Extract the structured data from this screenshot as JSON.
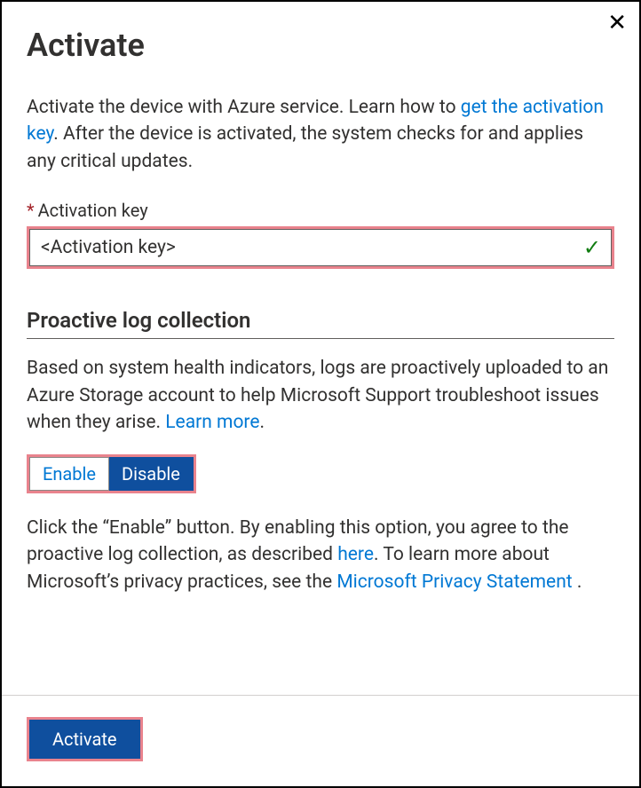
{
  "header": {
    "title": "Activate"
  },
  "intro": {
    "pre": "Activate the device with Azure service. Learn how to ",
    "link": "get the activation key",
    "post": ". After the device is activated, the system checks for and applies any critical updates."
  },
  "field": {
    "label": "Activation key",
    "value": "<Activation key>"
  },
  "section": {
    "title": "Proactive log collection",
    "desc_pre": "Based on system health indicators, logs are proactively uploaded to an Azure Storage account to help Microsoft Support troubleshoot issues when they arise. ",
    "desc_link": "Learn more",
    "desc_post": "."
  },
  "toggle": {
    "enable": "Enable",
    "disable": "Disable"
  },
  "agree": {
    "t1": "Click the “Enable” button. By enabling this option, you agree to the proactive log collection, as described ",
    "here": "here",
    "t2": ". To learn more about Microsoft’s privacy practices, see the ",
    "privacy": "Microsoft Privacy Statement",
    "t3": " ."
  },
  "footer": {
    "activate": "Activate"
  }
}
